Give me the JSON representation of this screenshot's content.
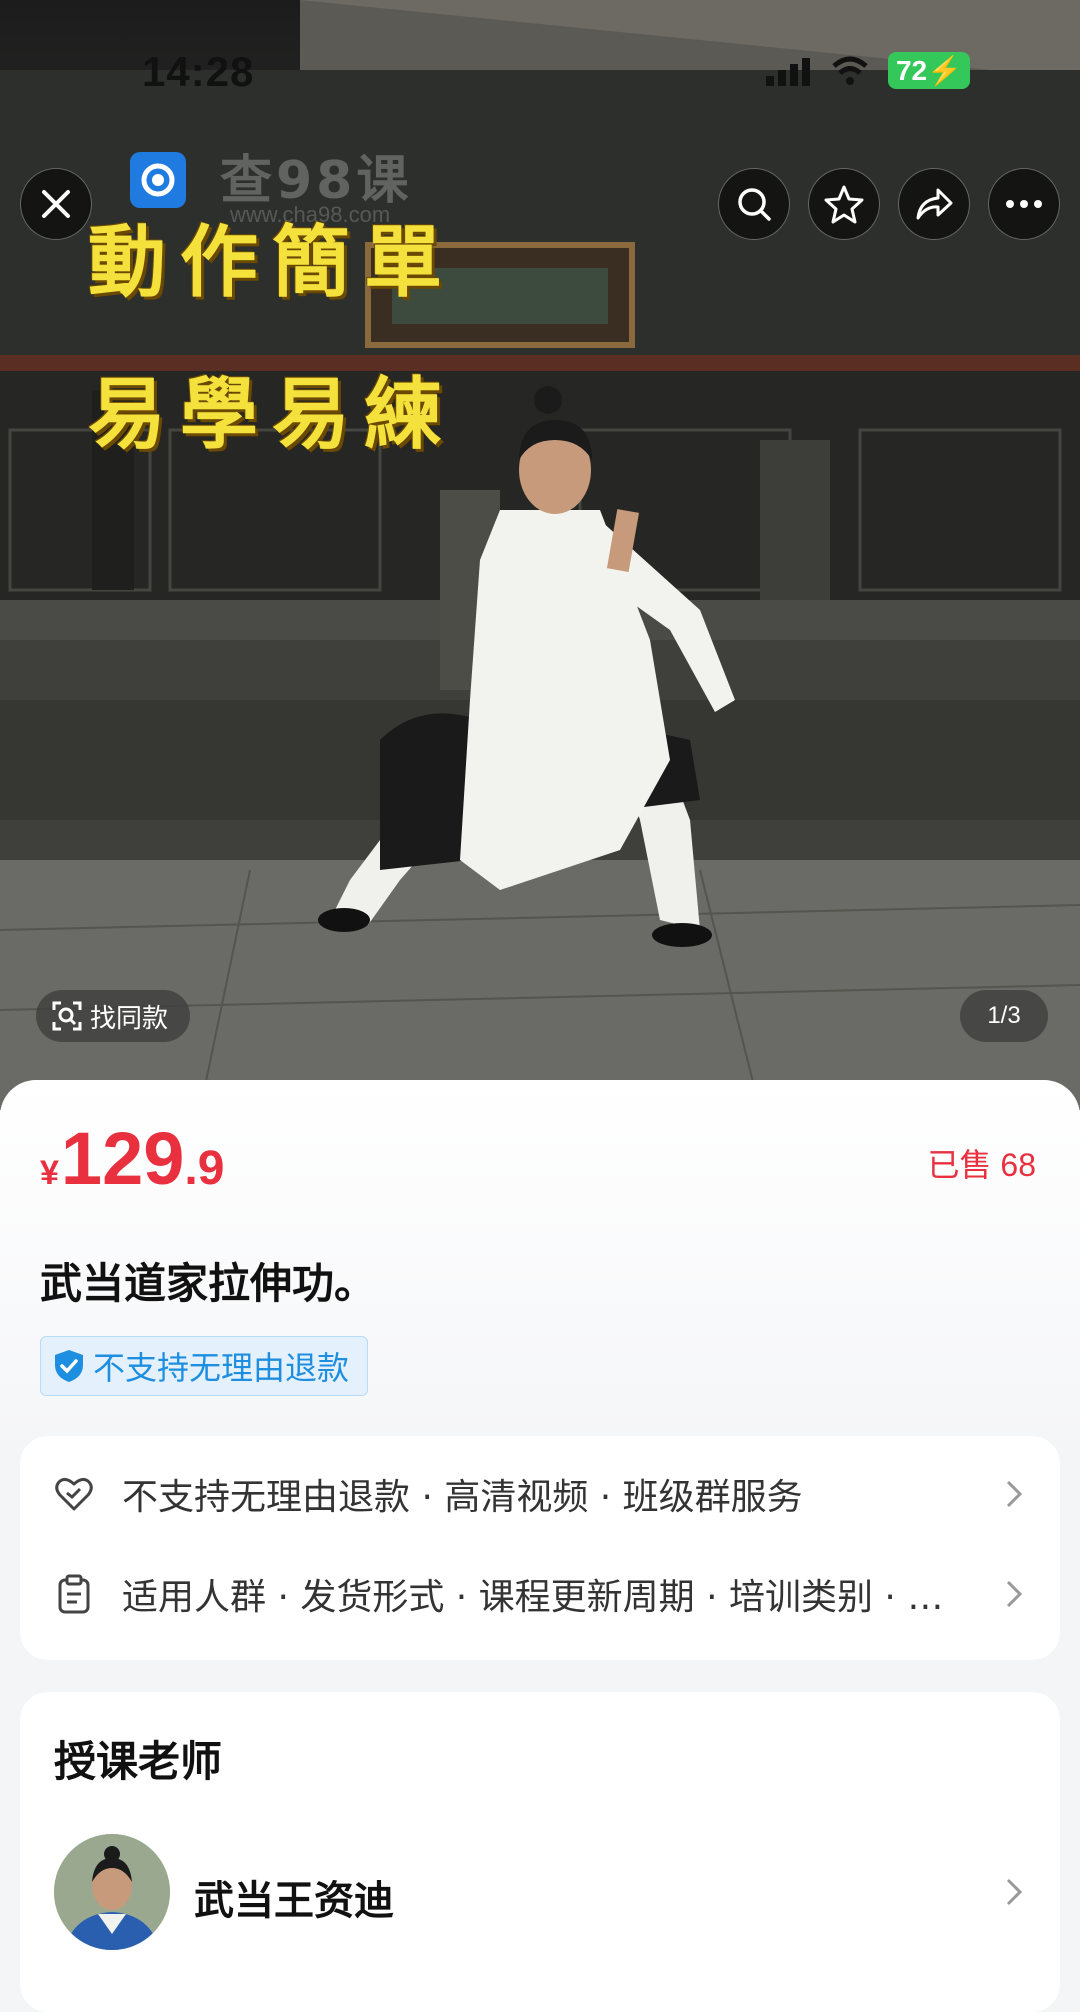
{
  "status_bar": {
    "time": "14:28",
    "battery": "72"
  },
  "watermark": {
    "text": "查98课",
    "sub": "www.cha98.com"
  },
  "promo": {
    "line1": "動作簡單",
    "line2": "易學易練"
  },
  "image_overlay": {
    "find_same": "找同款",
    "pager": "1/3"
  },
  "product": {
    "currency": "¥",
    "price_int": "129",
    "price_dec": ".9",
    "sold_label": "已售",
    "sold_count": "68",
    "title": "武当道家拉伸功。",
    "refund_badge": "不支持无理由退款"
  },
  "service": {
    "row1": "不支持无理由退款 · 高清视频 · 班级群服务",
    "row2": "适用人群 · 发货形式 · 课程更新周期 · 培训类别 · …"
  },
  "teacher": {
    "heading": "授课老师",
    "name": "武当王资迪"
  },
  "icons": [
    "close-icon",
    "search-icon",
    "star-icon",
    "share-icon",
    "more-icon",
    "scan-icon",
    "shield-icon",
    "heart-icon",
    "clipboard-icon",
    "chevron-right-icon"
  ]
}
